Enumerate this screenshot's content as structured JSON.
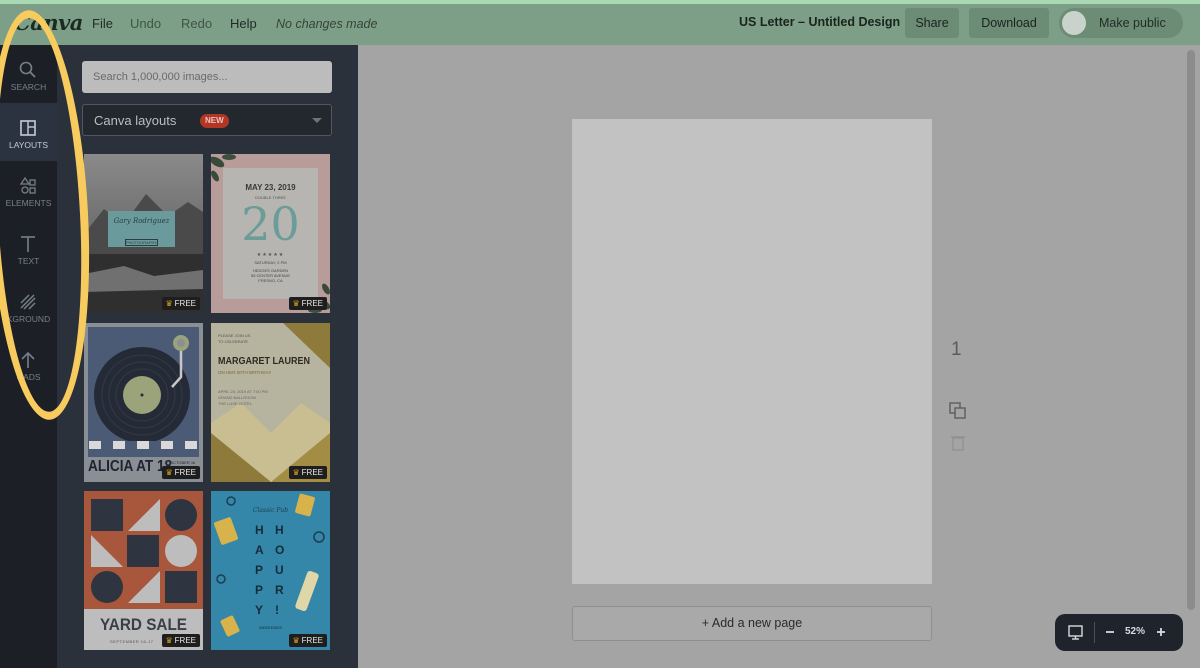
{
  "topbar": {
    "logo": "Canva",
    "menu": [
      "File",
      "Undo",
      "Redo",
      "Help"
    ],
    "status": "No changes made",
    "design_title": "US Letter – Untitled Design",
    "share_label": "Share",
    "download_label": "Download",
    "make_public_label": "Make public"
  },
  "rail": [
    {
      "label": "SEARCH",
      "icon": "search-icon"
    },
    {
      "label": "LAYOUTS",
      "icon": "layouts-icon"
    },
    {
      "label": "ELEMENTS",
      "icon": "elements-icon"
    },
    {
      "label": "TEXT",
      "icon": "text-icon"
    },
    {
      "label": "KGROUND",
      "icon": "background-icon"
    },
    {
      "label": "OADS",
      "icon": "uploads-icon"
    }
  ],
  "panel": {
    "search_placeholder": "Search 1,000,000 images...",
    "category": "Canva layouts",
    "badge": "NEW",
    "free_label": "FREE",
    "templates": {
      "t1": {
        "name": "Gary Rodriguez",
        "sub": "PHOTOGRAPHY"
      },
      "t2": {
        "date": "MAY 23, 2019",
        "big": "20",
        "sub": "DOUBLE THREE",
        "line1": "SATURDAY, 2 PM",
        "line2": "HEDGES GARDEN",
        "line3": "55 CENTER AVENUE",
        "line4": "FRESNO, CA"
      },
      "t3": {
        "name": "ALICIA AT 18",
        "sub": "OCTOBER 16"
      },
      "t4": {
        "top1": "PLEASE JOIN US",
        "top2": "TO CELEBRATE",
        "name": "MARGARET LAUREN",
        "sub": "ON HER 50TH BIRTHDAY",
        "line1": "APRIL 24, 2019 AT 7:00 PM",
        "line2": "GRAND BALLROOM",
        "line3": "THE LUXE HOTEL"
      },
      "t5": {
        "name": "YARD SALE",
        "sub": "SEPTEMBER 16-17"
      },
      "t6": {
        "top": "Classic Pub",
        "letters": [
          "H",
          "H",
          "A",
          "O",
          "P",
          "U",
          "P",
          "R",
          "Y",
          "!"
        ],
        "sub": "WEEKENDS"
      }
    }
  },
  "canvas": {
    "page_number": "1",
    "add_page_label": "+ Add a new page",
    "zoom_value": "52%"
  },
  "colors": {
    "topbar": "#7e9f87",
    "rail": "#1c2026",
    "panel": "#2b313b",
    "highlight": "#f8cb5e"
  }
}
